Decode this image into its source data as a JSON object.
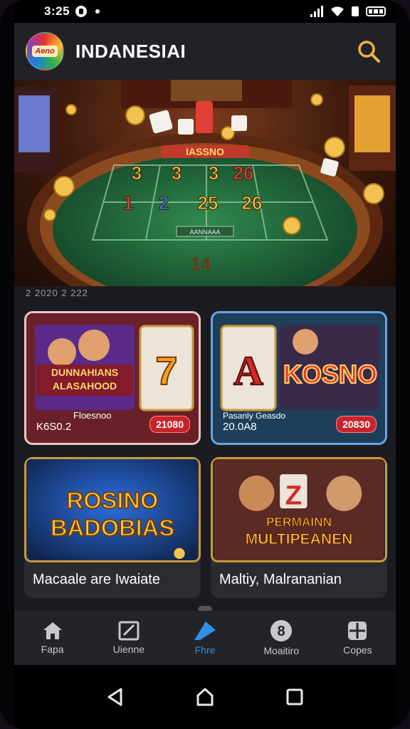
{
  "status": {
    "time": "3:25"
  },
  "app": {
    "title": "INDANESIAI",
    "logo_text": "Aeno"
  },
  "hero": {
    "table_sign": "IASSNO",
    "row1": [
      "3",
      "3",
      "3",
      "26"
    ],
    "row2": [
      "1",
      "2",
      "25",
      "26"
    ],
    "bottom_label": "14",
    "small_sign": "AANNAAA"
  },
  "section_label": "2 2020 2 222",
  "cards": [
    {
      "art_title": "DUNNAHIANS ALASAHOOD",
      "reel": "7",
      "sub": "Floesnoo",
      "value": "K6S0.2",
      "badge": "21080"
    },
    {
      "art_title": "KOSNO",
      "reel": "A",
      "sub": "Pasanly Geasdo",
      "value": "20.0A8",
      "badge": "20830"
    },
    {
      "art_title_top": "ROSINO",
      "art_title_bottom": "BADOBIAS",
      "caption": "Macaale are Iwaiate"
    },
    {
      "art_title_top": "PERMAINN",
      "art_title_bottom": "MULTIPEANEN",
      "reel": "Z",
      "caption": "Maltiy, Malrananian"
    }
  ],
  "nav": [
    {
      "label": "Fapa",
      "icon": "home-icon"
    },
    {
      "label": "Uienne",
      "icon": "edit-icon"
    },
    {
      "label": "Fhre",
      "icon": "play-icon",
      "active": true
    },
    {
      "label": "Moaitiro",
      "icon": "eight-ball-icon"
    },
    {
      "label": "Copes",
      "icon": "grid-icon"
    }
  ],
  "colors": {
    "accent": "#2f8ee5",
    "badge": "#c8232b",
    "felt": "#1f6b3a",
    "gold": "#f2c14e"
  }
}
